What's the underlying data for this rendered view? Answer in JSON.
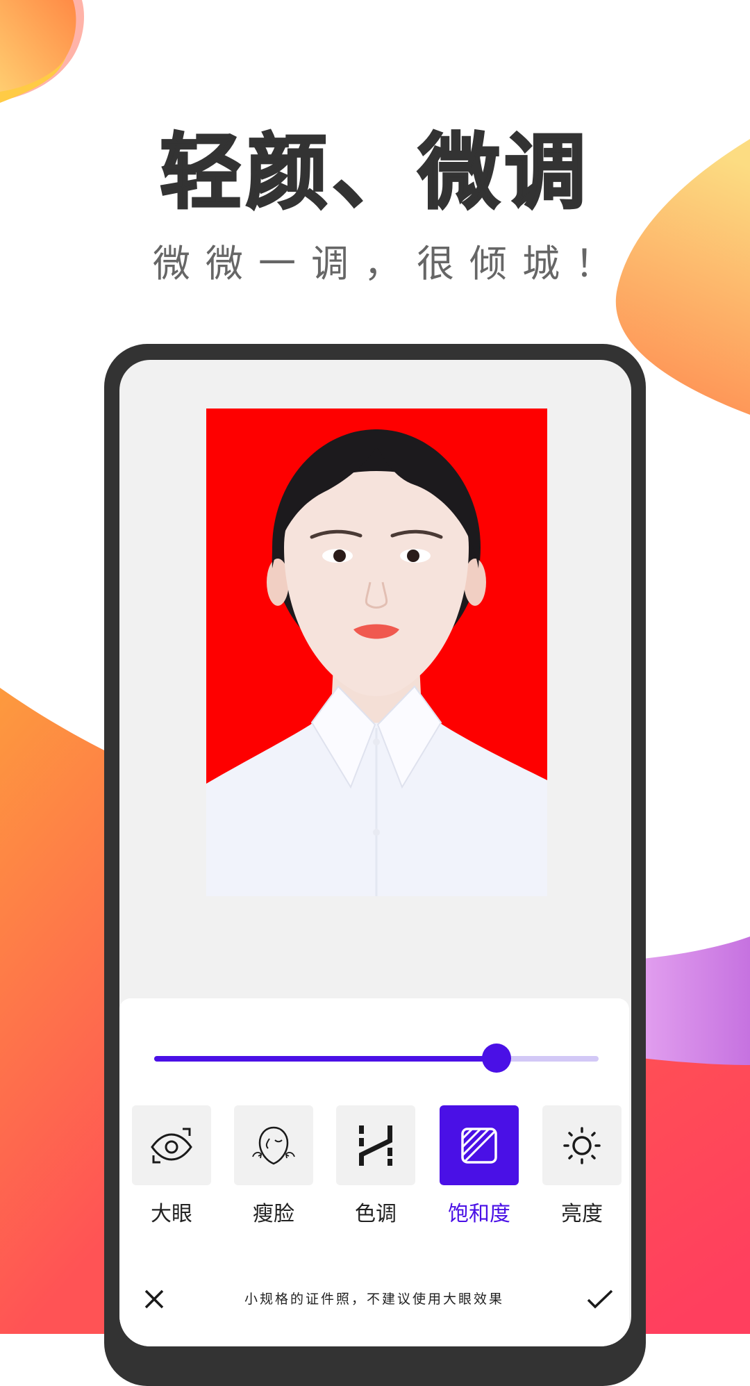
{
  "headline": {
    "title": "轻颜、微调",
    "subtitle": "微微一调，很倾城！"
  },
  "editor": {
    "photo": {
      "description": "ID photo of a woman in white shirt on red background",
      "background_color": "#fe0000"
    },
    "slider": {
      "value": 0.77,
      "active_color": "#4a10e6",
      "inactive_color": "#d2c8f6"
    },
    "tools": [
      {
        "id": "big-eyes",
        "label": "大眼",
        "icon": "eye-focus-icon",
        "active": false
      },
      {
        "id": "slim-face",
        "label": "瘦脸",
        "icon": "face-slim-icon",
        "active": false
      },
      {
        "id": "tone",
        "label": "色调",
        "icon": "tone-curve-icon",
        "active": false
      },
      {
        "id": "saturation",
        "label": "饱和度",
        "icon": "saturation-icon",
        "active": true
      },
      {
        "id": "brightness",
        "label": "亮度",
        "icon": "sun-icon",
        "active": false
      }
    ],
    "bottom_bar": {
      "cancel_icon": "close-icon",
      "hint": "小规格的证件照，不建议使用大眼效果",
      "confirm_icon": "check-icon"
    }
  },
  "colors": {
    "accent": "#4a10e6",
    "title_text": "#333333",
    "subtitle_text": "#666666",
    "phone_frame": "#333333",
    "screen_bg": "#f1f1f1"
  }
}
